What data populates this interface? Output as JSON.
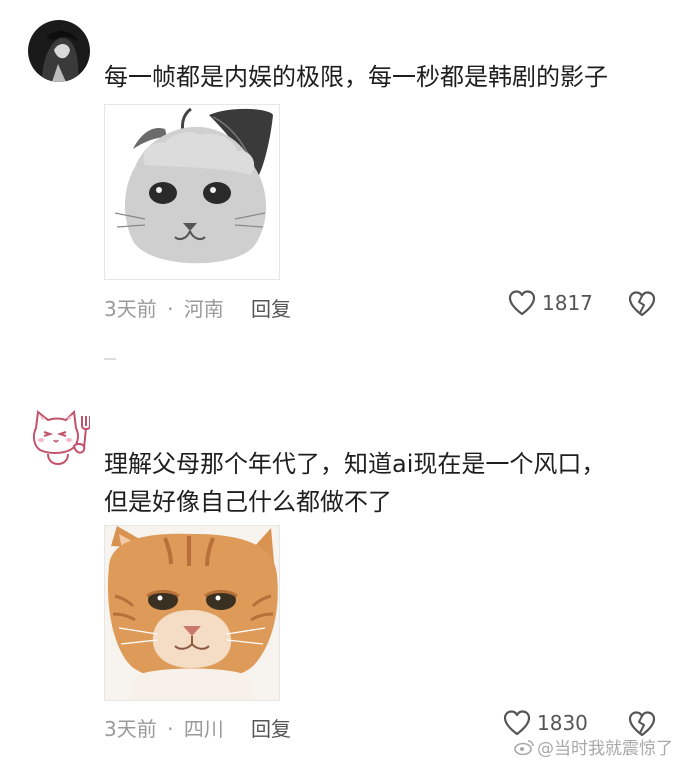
{
  "comments": [
    {
      "text": "每一帧都是内娱的极限，每一秒都是韩剧的影子",
      "time": "3天前",
      "location": "河南",
      "reply_label": "回复",
      "likes": "1817"
    },
    {
      "text_line1": "理解父母那个年代了，知道ai现在是一个风口，",
      "text_line2": "但是好像自己什么都做不了",
      "time": "3天前",
      "location": "四川",
      "reply_label": "回复",
      "likes": "1830"
    }
  ],
  "meta_separator": "·",
  "watermark": "@当时我就震惊了",
  "icons": {
    "like": "heart-outline-icon",
    "dislike": "broken-heart-icon",
    "avatar1": "dark-portrait",
    "avatar2": "cartoon-cat-with-fork",
    "sticker1": "gray-citrus-cat-face",
    "sticker2": "orange-tabby-cat"
  }
}
